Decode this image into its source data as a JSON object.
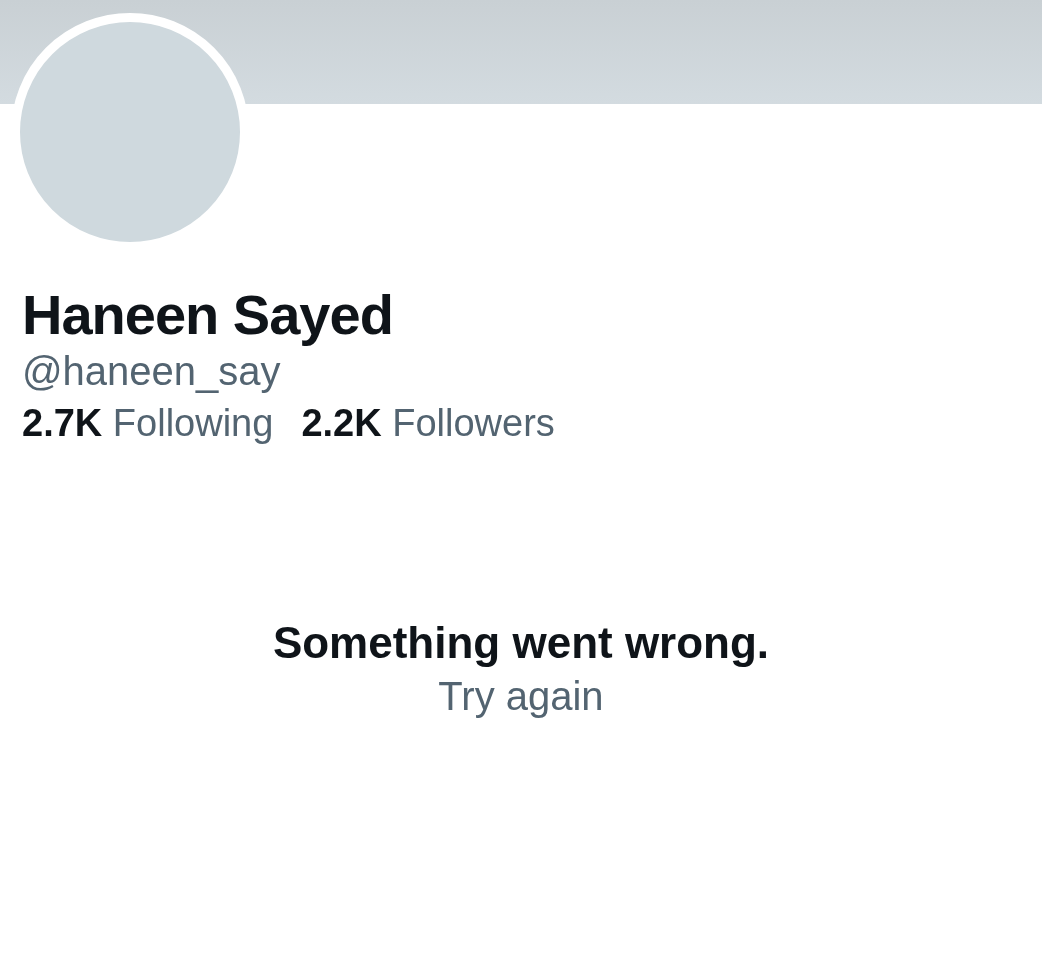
{
  "profile": {
    "name": "Haneen Sayed",
    "handle": "@haneen_say",
    "stats": [
      {
        "count": "2.7K",
        "label": "Following"
      },
      {
        "count": "2.2K",
        "label": "Followers"
      }
    ]
  },
  "error": {
    "message": "Something went wrong.",
    "action": "Try again"
  }
}
